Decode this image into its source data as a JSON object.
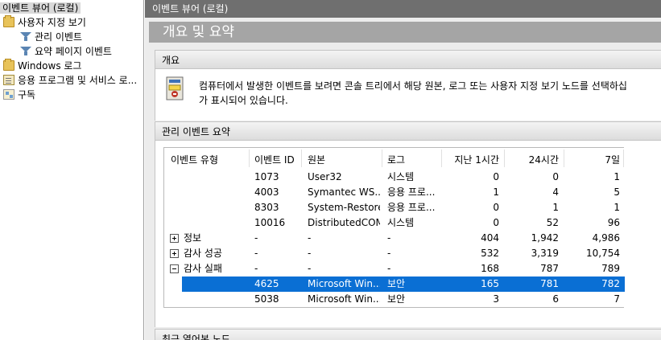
{
  "tree": {
    "root": "이벤트 뷰어 (로컬)",
    "custom_views": "사용자 지정 보기",
    "admin_events": "관리 이벤트",
    "summary_page_events": "요약 페이지 이벤트",
    "windows_logs": "Windows 로그",
    "app_service_logs": "응용 프로그램 및 서비스 로...",
    "subscriptions": "구독"
  },
  "right": {
    "title": "이벤트 뷰어 (로컬)",
    "page_title": "개요 및 요약"
  },
  "overview": {
    "header": "개요",
    "line1": "컴퓨터에서 발생한 이벤트를 보려면 콘솔 트리에서 해당 원본, 로그 또는 사용자 지정 보기 노드를 선택하십",
    "line2": "가 표시되어 있습니다."
  },
  "admin_summary": {
    "header": "관리 이벤트 요약",
    "columns": [
      "이벤트 유형",
      "이벤트 ID",
      "원본",
      "로그",
      "지난 1시간",
      "24시간",
      "7일"
    ],
    "rows": [
      {
        "type": "",
        "id": "1073",
        "source": "User32",
        "log": "시스템",
        "h1": "0",
        "h24": "0",
        "d7": "1"
      },
      {
        "type": "",
        "id": "4003",
        "source": "Symantec WS...",
        "log": "응용 프로...",
        "h1": "1",
        "h24": "4",
        "d7": "5"
      },
      {
        "type": "",
        "id": "8303",
        "source": "System-Restore",
        "log": "응용 프로...",
        "h1": "0",
        "h24": "1",
        "d7": "1"
      },
      {
        "type": "",
        "id": "10016",
        "source": "DistributedCOM",
        "log": "시스템",
        "h1": "0",
        "h24": "52",
        "d7": "96"
      },
      {
        "type": "정보",
        "id": "-",
        "source": "-",
        "log": "-",
        "h1": "404",
        "h24": "1,942",
        "d7": "4,986",
        "expander": "plus"
      },
      {
        "type": "감사 성공",
        "id": "-",
        "source": "-",
        "log": "-",
        "h1": "532",
        "h24": "3,319",
        "d7": "10,754",
        "expander": "plus"
      },
      {
        "type": "감사 실패",
        "id": "-",
        "source": "-",
        "log": "-",
        "h1": "168",
        "h24": "787",
        "d7": "789",
        "expander": "minus"
      },
      {
        "type": "",
        "id": "4625",
        "source": "Microsoft Win...",
        "log": "보안",
        "h1": "165",
        "h24": "781",
        "d7": "782",
        "selected": true
      },
      {
        "type": "",
        "id": "5038",
        "source": "Microsoft Win...",
        "log": "보안",
        "h1": "3",
        "h24": "6",
        "d7": "7"
      }
    ]
  },
  "recent_nodes": {
    "header": "최근 열어본 노드"
  }
}
